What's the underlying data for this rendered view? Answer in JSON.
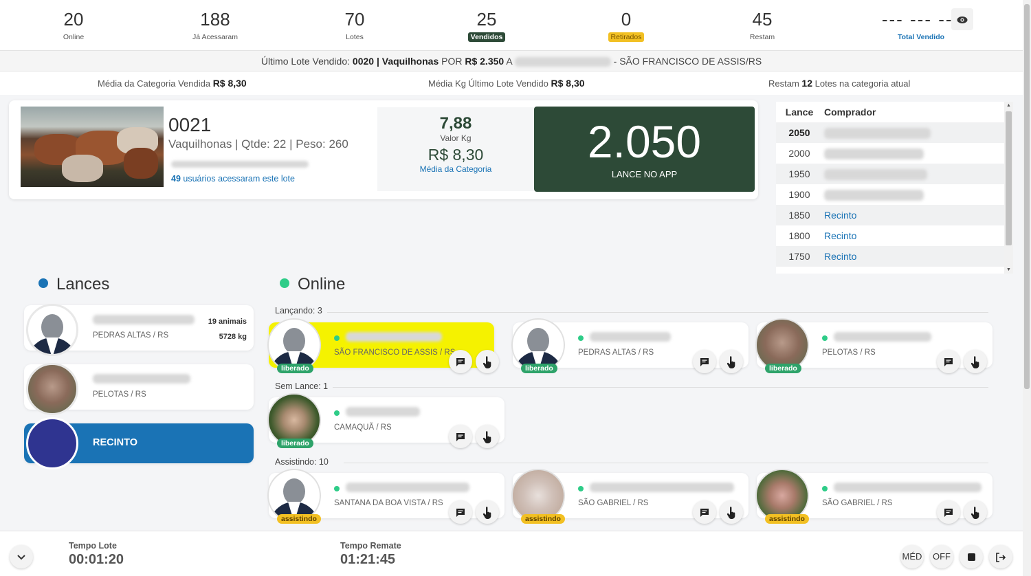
{
  "stats": {
    "online": {
      "value": "20",
      "label": "Online"
    },
    "accessed": {
      "value": "188",
      "label": "Já Acessaram"
    },
    "lots": {
      "value": "70",
      "label": "Lotes"
    },
    "sold": {
      "value": "25",
      "label": "Vendidos"
    },
    "withdrawn": {
      "value": "0",
      "label": "Retirados"
    },
    "remaining": {
      "value": "45",
      "label": "Restam"
    },
    "total_sold": {
      "value": "--- --- ---",
      "label": "Total Vendido"
    }
  },
  "last_lot": {
    "prefix": "Último Lote Vendido:",
    "lot": "0020 | Vaquilhonas",
    "por": "POR",
    "price": "R$ 2.350",
    "a": "A",
    "location": "- SÃO FRANCISCO DE ASSIS/RS"
  },
  "averages": {
    "category_label": "Média da Categoria Vendida",
    "category_value": "R$ 8,30",
    "lastkg_label": "Média Kg Último Lote Vendido",
    "lastkg_value": "R$ 8,30",
    "remaining_prefix": "Restam",
    "remaining_count": "12",
    "remaining_suffix": "Lotes na categoria atual"
  },
  "current_lot": {
    "number": "0021",
    "description": "Vaquilhonas | Qtde: 22 | Peso: 260",
    "users_count": "49",
    "users_text": "usuários acessaram este lote",
    "kg_value": "7,88",
    "kg_label": "Valor Kg",
    "category_value": "R$ 8,30",
    "category_label": "Média da Categoria",
    "bid_value": "2.050",
    "bid_label": "LANCE NO APP"
  },
  "bid_table": {
    "col_bid": "Lance",
    "col_buyer": "Comprador",
    "rows": [
      {
        "bid": "2050",
        "buyer": ""
      },
      {
        "bid": "2000",
        "buyer": ""
      },
      {
        "bid": "1950",
        "buyer": ""
      },
      {
        "bid": "1900",
        "buyer": ""
      },
      {
        "bid": "1850",
        "buyer": "Recinto"
      },
      {
        "bid": "1800",
        "buyer": "Recinto"
      },
      {
        "bid": "1750",
        "buyer": "Recinto"
      }
    ]
  },
  "lances": {
    "title": "Lances",
    "cards": [
      {
        "city": "PEDRAS ALTAS / RS",
        "animals": "19 animais",
        "weight": "5728 kg"
      },
      {
        "city": "PELOTAS / RS"
      }
    ],
    "recinto_label": "RECINTO"
  },
  "online": {
    "title": "Online",
    "groups": {
      "bidding": "Lançando: 3",
      "no_bid": "Sem Lance: 1",
      "watching": "Assistindo: 10"
    },
    "users": [
      {
        "city": "SÃO FRANCISCO DE ASSIS / RS",
        "badge": "liberado"
      },
      {
        "city": "PEDRAS ALTAS / RS",
        "badge": "liberado"
      },
      {
        "city": "PELOTAS / RS",
        "badge": "liberado"
      },
      {
        "city": "CAMAQUÃ / RS",
        "badge": "liberado"
      },
      {
        "city": "SANTANA DA BOA VISTA / RS",
        "badge": "assistindo"
      },
      {
        "city": "SÃO GABRIEL / RS",
        "badge": "assistindo"
      },
      {
        "city": "SÃO GABRIEL / RS",
        "badge": "assistindo"
      }
    ]
  },
  "footer": {
    "lot_time_label": "Tempo Lote",
    "lot_time": "00:01:20",
    "auction_time_label": "Tempo Remate",
    "auction_time": "01:21:45",
    "btn_med": "MÉD",
    "btn_off": "OFF"
  },
  "colors": {
    "accent_green": "#2d4a37",
    "accent_blue": "#1a73b5",
    "online_green": "#2ecc88",
    "badge_yellow": "#f2c023",
    "highlight_yellow": "#f5f200"
  },
  "icons": {
    "eye": "eye-icon",
    "chat": "chat-icon",
    "hand": "hand-pointer-icon",
    "chevron": "chevron-down-icon",
    "stop": "stop-icon",
    "logout": "logout-icon"
  }
}
